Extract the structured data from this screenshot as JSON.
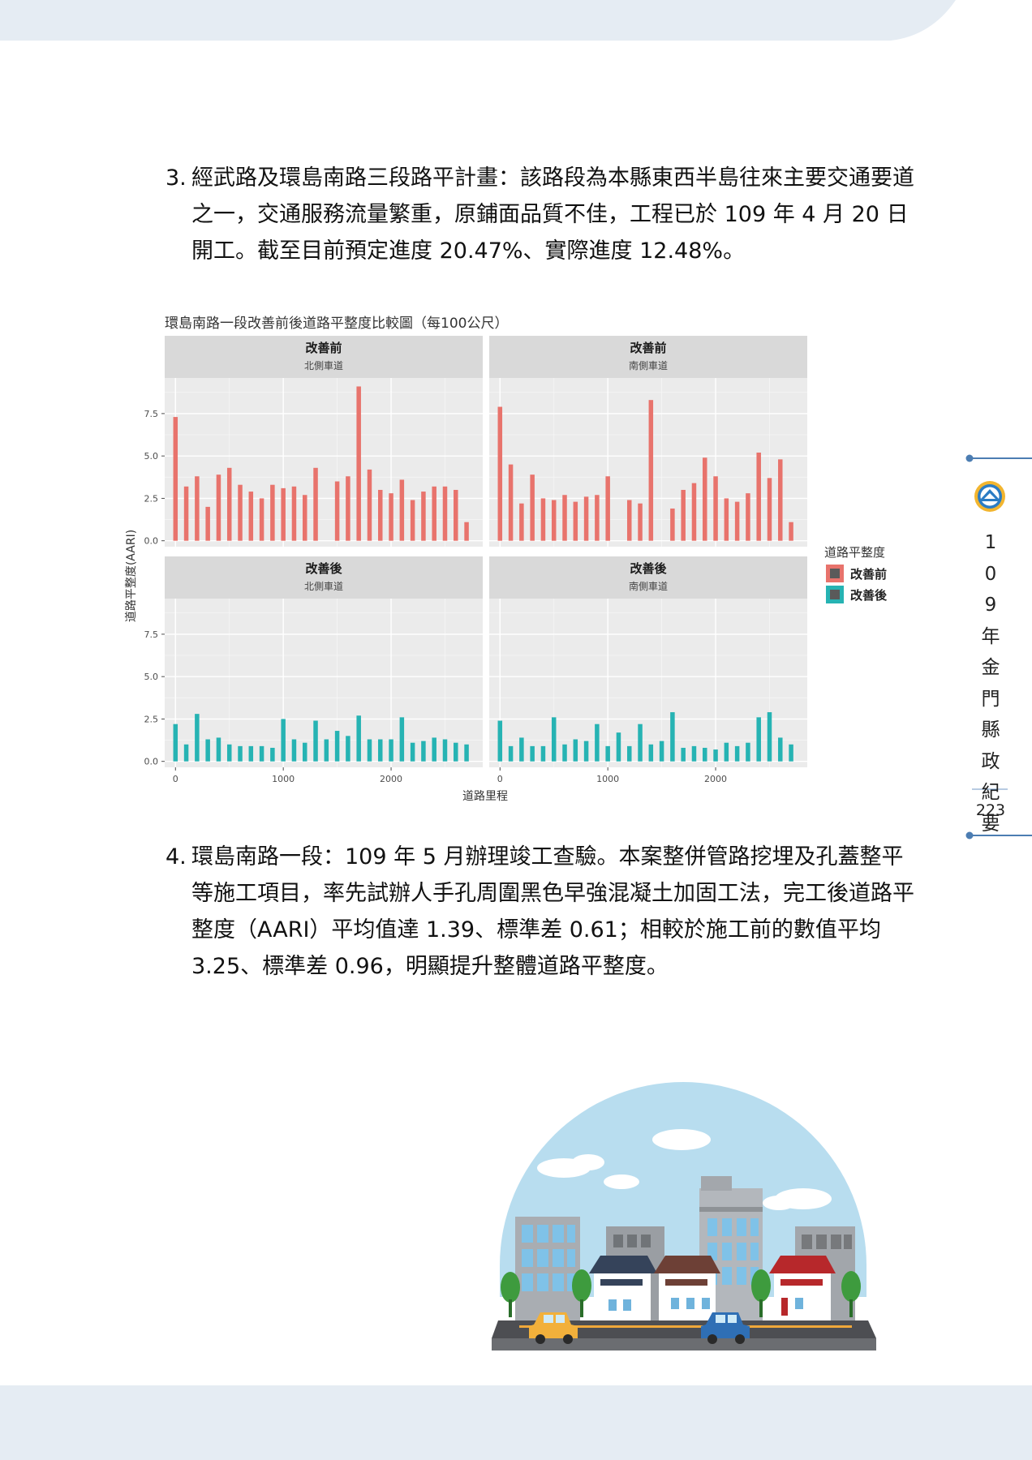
{
  "paragraphs": {
    "p3": {
      "number": "3.",
      "text": "經武路及環島南路三段路平計畫：該路段為本縣東西半島往來主要交通要道之一，交通服務流量繁重，原鋪面品質不佳，工程已於 109 年 4 月 20 日開工。截至目前預定進度 20.47%、實際進度 12.48%。"
    },
    "p4": {
      "number": "4.",
      "text": "環島南路一段：109 年 5 月辦理竣工查驗。本案整併管路挖埋及孔蓋整平等施工項目，率先試辦人手孔周圍黑色早強混凝土加固工法，完工後道路平整度（AARI）平均值達 1.39、標準差 0.61；相較於施工前的數值平均 3.25、標準差 0.96，明顯提升整體道路平整度。"
    }
  },
  "sidebar": {
    "title": "109年金門縣政紀要",
    "title_chars": [
      "1",
      "0",
      "9",
      "年",
      "金",
      "門",
      "縣",
      "政",
      "紀",
      "要"
    ],
    "page_number": "223"
  },
  "chart_data": {
    "type": "bar",
    "title": "環島南路一段改善前後道路平整度比較圖（每100公尺）",
    "xlabel": "道路里程",
    "ylabel": "道路平整度(AARI)",
    "xlim": [
      -100,
      2850
    ],
    "ylim": [
      -0.35,
      9.6
    ],
    "x_ticks": [
      {
        "v": 0,
        "l": "0"
      },
      {
        "v": 1000,
        "l": "1000"
      },
      {
        "v": 2000,
        "l": "2000"
      }
    ],
    "y_ticks": [
      {
        "v": 0,
        "l": "0.0"
      },
      {
        "v": 2.5,
        "l": "2.5"
      },
      {
        "v": 5,
        "l": "5.0"
      },
      {
        "v": 7.5,
        "l": "7.5"
      }
    ],
    "grid": true,
    "legend": {
      "title": "道路平整度",
      "position": "right",
      "entries": [
        {
          "label": "改善前",
          "color": "#e8736c"
        },
        {
          "label": "改善後",
          "color": "#26b3b3"
        }
      ]
    },
    "panels": [
      {
        "strip_top": "改善前",
        "strip_sub": "北側車道",
        "color": "#e8736c",
        "x": [
          0,
          100,
          200,
          300,
          400,
          500,
          600,
          700,
          800,
          900,
          1000,
          1100,
          1200,
          1300,
          1500,
          1600,
          1700,
          1800,
          1900,
          2000,
          2100,
          2200,
          2300,
          2400,
          2500,
          2600,
          2700
        ],
        "values": [
          7.3,
          3.2,
          3.8,
          2.0,
          3.9,
          4.3,
          3.3,
          2.9,
          2.5,
          3.3,
          3.1,
          3.2,
          2.7,
          4.3,
          3.5,
          3.8,
          9.1,
          4.2,
          3.0,
          2.8,
          3.6,
          2.4,
          2.9,
          3.2,
          3.2,
          3.0,
          1.1
        ]
      },
      {
        "strip_top": "改善前",
        "strip_sub": "南側車道",
        "color": "#e8736c",
        "x": [
          0,
          100,
          200,
          300,
          400,
          500,
          600,
          700,
          800,
          900,
          1000,
          1200,
          1300,
          1400,
          1600,
          1700,
          1800,
          1900,
          2000,
          2100,
          2200,
          2300,
          2400,
          2500,
          2600,
          2700
        ],
        "values": [
          7.9,
          4.5,
          2.2,
          3.9,
          2.5,
          2.4,
          2.7,
          2.3,
          2.6,
          2.7,
          3.8,
          2.4,
          2.2,
          8.3,
          1.9,
          3.0,
          3.4,
          4.9,
          3.8,
          2.5,
          2.3,
          2.8,
          5.2,
          3.7,
          4.8,
          1.1
        ]
      },
      {
        "strip_top": "改善後",
        "strip_sub": "北側車道",
        "color": "#26b3b3",
        "x": [
          0,
          100,
          200,
          300,
          400,
          500,
          600,
          700,
          800,
          900,
          1000,
          1100,
          1200,
          1300,
          1400,
          1500,
          1600,
          1700,
          1800,
          1900,
          2000,
          2100,
          2200,
          2300,
          2400,
          2500,
          2600,
          2700
        ],
        "values": [
          2.2,
          1.0,
          2.8,
          1.3,
          1.4,
          1.0,
          0.9,
          0.9,
          0.9,
          0.8,
          2.5,
          1.3,
          1.1,
          2.4,
          1.3,
          1.8,
          1.5,
          2.7,
          1.3,
          1.3,
          1.3,
          2.6,
          1.1,
          1.2,
          1.4,
          1.3,
          1.1,
          1.0
        ]
      },
      {
        "strip_top": "改善後",
        "strip_sub": "南側車道",
        "color": "#26b3b3",
        "x": [
          0,
          100,
          200,
          300,
          400,
          500,
          600,
          700,
          800,
          900,
          1000,
          1100,
          1200,
          1300,
          1400,
          1500,
          1600,
          1700,
          1800,
          1900,
          2000,
          2100,
          2200,
          2300,
          2400,
          2500,
          2600,
          2700
        ],
        "values": [
          2.4,
          0.9,
          1.4,
          0.9,
          0.9,
          2.6,
          1.0,
          1.3,
          1.2,
          2.2,
          0.9,
          1.7,
          0.9,
          2.2,
          1.0,
          1.2,
          2.9,
          0.8,
          0.9,
          0.8,
          0.7,
          1.1,
          0.9,
          1.1,
          2.6,
          2.9,
          1.4,
          1.0
        ]
      }
    ]
  }
}
